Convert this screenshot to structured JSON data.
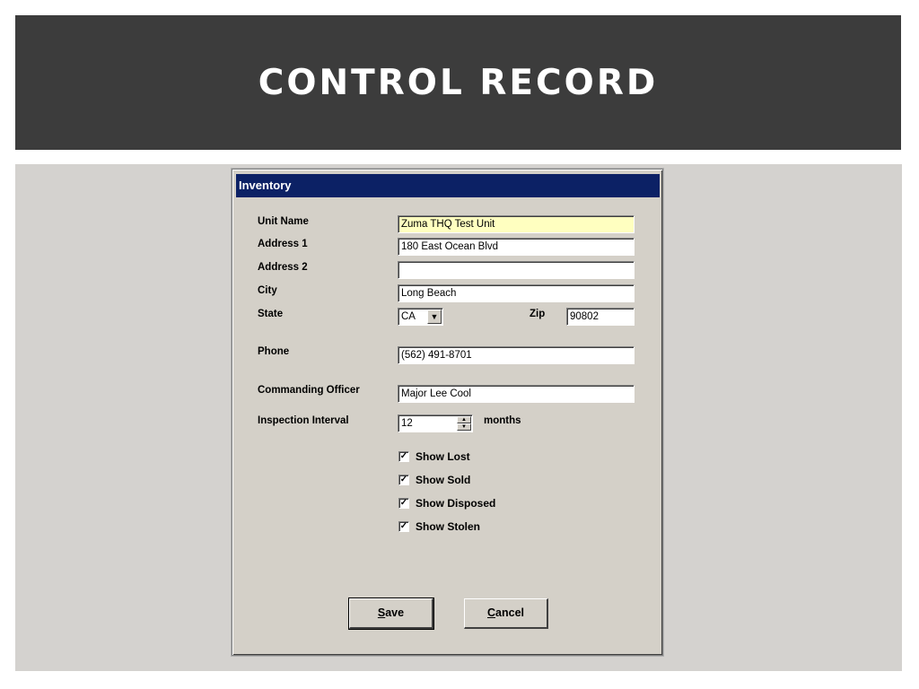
{
  "slide": {
    "title": "CONTROL RECORD"
  },
  "dialog": {
    "title": "Inventory",
    "labels": {
      "unit_name": "Unit Name",
      "address1": "Address 1",
      "address2": "Address 2",
      "city": "City",
      "state": "State",
      "zip": "Zip",
      "phone": "Phone",
      "commanding_officer": "Commanding Officer",
      "inspection_interval": "Inspection Interval",
      "months": "months"
    },
    "values": {
      "unit_name": "Zuma THQ Test Unit",
      "address1": "180 East Ocean Blvd",
      "address2": "",
      "city": "Long Beach",
      "state": "CA",
      "zip": "90802",
      "phone": "(562) 491-8701",
      "commanding_officer": "Major Lee Cool",
      "inspection_interval": "12"
    },
    "checkboxes": [
      {
        "label": "Show Lost",
        "checked": true
      },
      {
        "label": "Show Sold",
        "checked": true
      },
      {
        "label": "Show Disposed",
        "checked": true
      },
      {
        "label": "Show Stolen",
        "checked": true
      }
    ],
    "buttons": {
      "save_ul": "S",
      "save_rest": "ave",
      "cancel_ul": "C",
      "cancel_rest": "ancel"
    },
    "icons": {
      "dropdown": "chevron-down-icon",
      "spin": "spinner-icon",
      "check": "checkmark-icon"
    }
  }
}
